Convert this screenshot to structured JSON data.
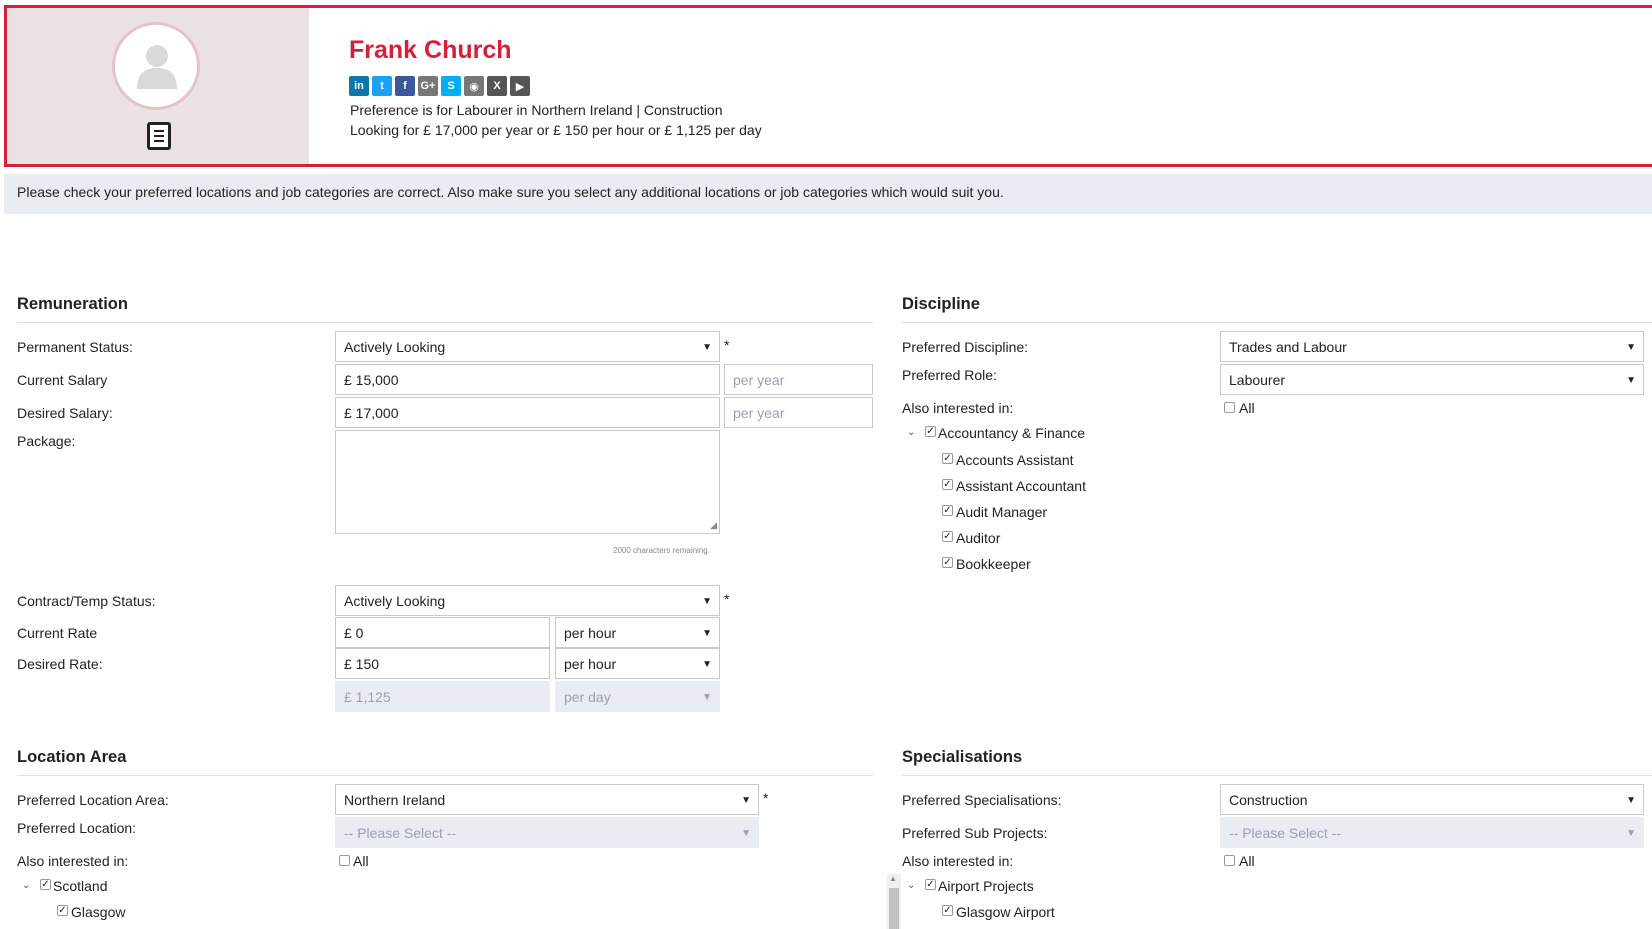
{
  "profile": {
    "name": "Frank Church",
    "preference_line": "Preference is for Labourer in Northern Ireland | Construction",
    "looking_line": "Looking for £ 17,000 per year or £ 150 per hour or £ 1,125 per day",
    "socials": [
      {
        "icon": "linkedin-icon",
        "glyph": "in",
        "color": "#0e76a8"
      },
      {
        "icon": "twitter-icon",
        "glyph": "t",
        "color": "#1da1f2"
      },
      {
        "icon": "facebook-icon",
        "glyph": "f",
        "color": "#3b5998"
      },
      {
        "icon": "googleplus-icon",
        "glyph": "G+",
        "color": "#777777"
      },
      {
        "icon": "skype-icon",
        "glyph": "S",
        "color": "#00aff0"
      },
      {
        "icon": "pocket-icon",
        "glyph": "◉",
        "color": "#777777"
      },
      {
        "icon": "xing-icon",
        "glyph": "X",
        "color": "#555555"
      },
      {
        "icon": "youtube-icon",
        "glyph": "▶",
        "color": "#555555"
      }
    ]
  },
  "notice": "Please check your preferred locations and job categories are correct. Also make sure you select any additional locations or job categories which would suit you.",
  "remuneration": {
    "title": "Remuneration",
    "permanent_status_label": "Permanent Status:",
    "permanent_status_value": "Actively Looking",
    "current_salary_label": "Current Salary",
    "current_salary_value": "£  15,000",
    "current_salary_period": "per year",
    "desired_salary_label": "Desired Salary:",
    "desired_salary_value": "£  17,000",
    "desired_salary_period": "per year",
    "package_label": "Package:",
    "package_chars": "2000 characters remaining.",
    "contract_status_label": "Contract/Temp Status:",
    "contract_status_value": "Actively Looking",
    "current_rate_label": "Current Rate",
    "current_rate_value": "£  0",
    "current_rate_period": "per hour",
    "desired_rate_label": "Desired Rate:",
    "desired_rate_value": "£  150",
    "desired_rate_period": "per hour",
    "day_rate_value": "£  1,125",
    "day_rate_period": "per day",
    "required_mark": "*"
  },
  "discipline": {
    "title": "Discipline",
    "preferred_discipline_label": "Preferred Discipline:",
    "preferred_discipline_value": "Trades and Labour",
    "preferred_role_label": "Preferred Role:",
    "preferred_role_value": "Labourer",
    "also_label": "Also interested in:",
    "all_label": "All",
    "tree_parent": "Accountancy & Finance",
    "tree_children": [
      "Accounts Assistant",
      "Assistant Accountant",
      "Audit Manager",
      "Auditor",
      "Bookkeeper"
    ]
  },
  "location": {
    "title": "Location Area",
    "area_label": "Preferred Location Area:",
    "area_value": "Northern Ireland",
    "location_label": "Preferred Location:",
    "location_placeholder": "-- Please Select --",
    "also_label": "Also interested in:",
    "all_label": "All",
    "tree_parent": "Scotland",
    "tree_child": "Glasgow"
  },
  "specialisations": {
    "title": "Specialisations",
    "spec_label": "Preferred Specialisations:",
    "spec_value": "Construction",
    "sub_label": "Preferred Sub Projects:",
    "sub_placeholder": "-- Please Select --",
    "also_label": "Also interested in:",
    "all_label": "All",
    "tree_parent": "Airport Projects",
    "tree_child": "Glasgow Airport"
  },
  "colors": {
    "accent": "#d6203a",
    "panel": "#ebe2e4",
    "notice_bg": "#e9ecf2"
  }
}
